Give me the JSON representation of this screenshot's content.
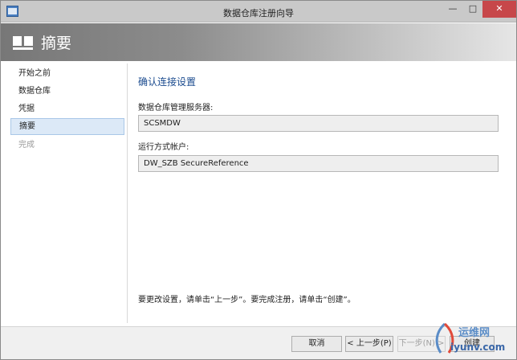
{
  "window": {
    "title": "数据仓库注册向导",
    "controls": {
      "minimize": "—",
      "maximize": "□",
      "close": "✕"
    }
  },
  "header": {
    "title": "摘要",
    "icon": "wizard-icon"
  },
  "nav": {
    "items": [
      {
        "label": "开始之前",
        "state": "normal"
      },
      {
        "label": "数据仓库",
        "state": "normal"
      },
      {
        "label": "凭据",
        "state": "normal"
      },
      {
        "label": "摘要",
        "state": "selected"
      },
      {
        "label": "完成",
        "state": "disabled"
      }
    ]
  },
  "main": {
    "section_title": "确认连接设置",
    "server_label": "数据仓库管理服务器:",
    "server_value": "SCSMDW",
    "account_label": "运行方式帐户:",
    "account_value": "DW_SZB SecureReference",
    "hint": "要更改设置，请单击“上一步”。要完成注册，请单击“创建”。"
  },
  "footer": {
    "cancel": "取消",
    "prev": "< 上一步(P)",
    "next": "下一步(N) >",
    "create": "创建"
  },
  "watermark": {
    "line1": "运维网",
    "line2": "iyunv.com"
  },
  "colors": {
    "accent": "#1b4b8f",
    "selection": "#dce9f7",
    "close_button": "#c7474a"
  }
}
